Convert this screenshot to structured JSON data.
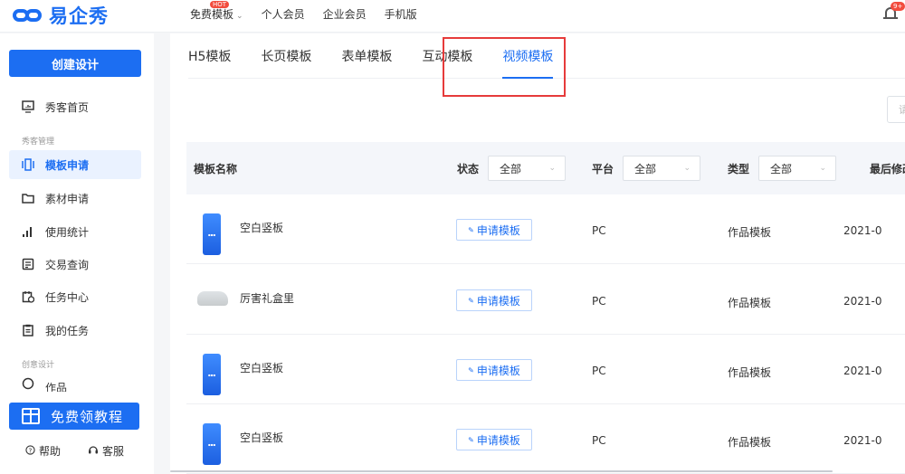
{
  "brand": {
    "name": "易企秀",
    "color": "#1c6ef2"
  },
  "topnav": {
    "items": [
      {
        "label": "免费模板",
        "has_dropdown": true,
        "badge": "HOT"
      },
      {
        "label": "个人会员"
      },
      {
        "label": "企业会员"
      },
      {
        "label": "手机版"
      }
    ],
    "notification_badge": "9+"
  },
  "sidebar": {
    "create_button": "创建设计",
    "items": [
      {
        "label": "秀客首页",
        "icon": "monitor-icon",
        "active": false
      },
      {
        "label": "模板申请",
        "icon": "template-icon",
        "active": true
      },
      {
        "label": "素材申请",
        "icon": "folder-icon",
        "active": false
      },
      {
        "label": "使用统计",
        "icon": "bar-chart-icon",
        "active": false
      },
      {
        "label": "交易查询",
        "icon": "receipt-icon",
        "active": false
      },
      {
        "label": "任务中心",
        "icon": "calendar-icon",
        "active": false
      },
      {
        "label": "我的任务",
        "icon": "clipboard-icon",
        "active": false
      },
      {
        "label": "作品",
        "icon": "circle-icon",
        "active": false
      }
    ],
    "group_labels": [
      "秀客管理",
      "创意设计"
    ],
    "tutorial_button": "免费领教程",
    "footer": {
      "help": "帮助",
      "service": "客服"
    }
  },
  "tabs": [
    {
      "label": "H5模板",
      "active": false
    },
    {
      "label": "长页模板",
      "active": false
    },
    {
      "label": "表单模板",
      "active": false
    },
    {
      "label": "互动模板",
      "active": false
    },
    {
      "label": "视频模板",
      "active": true
    }
  ],
  "search": {
    "placeholder": "请"
  },
  "table": {
    "headers": {
      "name": "模板名称",
      "status": "状态",
      "platform": "平台",
      "type": "类型",
      "last_modified": "最后修改"
    },
    "filters": {
      "status": "全部",
      "platform": "全部",
      "type": "全部"
    },
    "apply_label": "申请模板",
    "rows": [
      {
        "name": "空白竖板",
        "platform": "PC",
        "type": "作品模板",
        "date": "2021-0",
        "thumb": "video-thumb"
      },
      {
        "name": "厉害礼盒里",
        "platform": "PC",
        "type": "作品模板",
        "date": "2021-0",
        "thumb": "shoe-thumb"
      },
      {
        "name": "空白竖板",
        "platform": "PC",
        "type": "作品模板",
        "date": "2021-0",
        "thumb": "video-thumb"
      },
      {
        "name": "空白竖板",
        "platform": "PC",
        "type": "作品模板",
        "date": "2021-0",
        "thumb": "video-thumb"
      }
    ]
  },
  "colors": {
    "accent": "#1c6ef2",
    "highlight": "#e63b3b"
  }
}
